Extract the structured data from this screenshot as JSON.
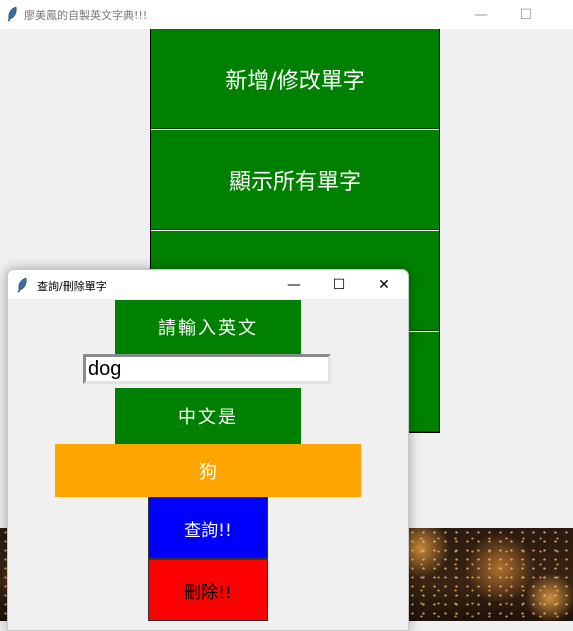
{
  "main_window": {
    "title": "廖美鳳的自製英文字典!!!",
    "controls": {
      "minimize": "—",
      "maximize": "☐",
      "close": "✕"
    },
    "menu_buttons": [
      "新增/修改單字",
      "顯示所有單字",
      "",
      ""
    ],
    "colors": {
      "menu_bg": "#008000",
      "menu_text": "#ffffff"
    }
  },
  "dialog": {
    "title": "查詢/刪除單字",
    "controls": {
      "minimize": "—",
      "maximize": "☐",
      "close": "✕"
    },
    "prompt_label": "請輸入英文",
    "english_input": {
      "value": "dog"
    },
    "chinese_label": "中文是",
    "result": "狗",
    "query_button": "查詢!!",
    "delete_button": "刪除!!",
    "colors": {
      "label_bg": "#008000",
      "result_bg": "#ffa500",
      "query_bg": "#0000ff",
      "delete_bg": "#ff0000"
    }
  }
}
